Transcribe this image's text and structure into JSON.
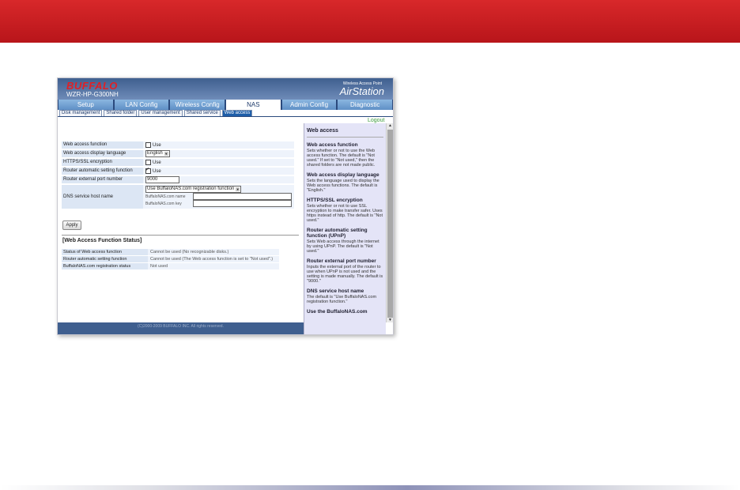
{
  "header": {
    "brand": "BUFFALO",
    "model": "WZR-HP-G300NH",
    "wap_label": "Wireless Access Point",
    "product": "AirStation"
  },
  "tabs": [
    {
      "label": "Setup",
      "active": false
    },
    {
      "label": "LAN Config",
      "active": false
    },
    {
      "label": "Wireless Config",
      "active": false
    },
    {
      "label": "NAS",
      "active": true
    },
    {
      "label": "Admin Config",
      "active": false
    },
    {
      "label": "Diagnostic",
      "active": false
    }
  ],
  "subtabs": [
    {
      "label": "Disk management",
      "active": false
    },
    {
      "label": "Shared folder",
      "active": false
    },
    {
      "label": "User management",
      "active": false
    },
    {
      "label": "Shared service",
      "active": false
    },
    {
      "label": "Web access",
      "active": true
    }
  ],
  "logout": "Logout",
  "form": {
    "web_access_function": {
      "label": "Web access function",
      "option": "Use",
      "checked": false
    },
    "display_language": {
      "label": "Web access display language",
      "value": "English"
    },
    "https": {
      "label": "HTTPS/SSL encryption",
      "option": "Use",
      "checked": false
    },
    "router_auto": {
      "label": "Router automatic setting function",
      "option": "Use",
      "checked": true
    },
    "external_port": {
      "label": "Router external port number",
      "value": "9000"
    },
    "dns": {
      "label": "DNS service host name",
      "select_value": "Use BuffaloNAS.com registration function",
      "name_label": "BuffaloNAS.com name",
      "key_label": "BuffaloNAS.com key"
    },
    "apply_label": "Apply"
  },
  "status": {
    "title": "[Web Access Function Status]",
    "rows": [
      {
        "label": "Status of Web access function",
        "value": "Cannot be used (No recognizable disks.)"
      },
      {
        "label": "Router automatic setting function",
        "value": "Cannot be used (The Web access function is set to \"Not used\".)"
      },
      {
        "label": "BuffaloNAS.com registration status",
        "value": "Not used"
      }
    ]
  },
  "footer": "(C)2000-2009 BUFFALO INC. All rights reserved.",
  "help": {
    "title": "Web access",
    "sections": [
      {
        "title": "Web access function",
        "text": "Sets whether or not to use the Web access function. The default is \"Not used.\" If set to \"Not used,\" then the shared folders are not made public."
      },
      {
        "title": "Web access display language",
        "text": "Sets the language used to display the Web access functions. The default is \"English.\""
      },
      {
        "title": "HTTPS/SSL encryption",
        "text": "Sets whether or not to use SSL encryption to make transfer safer. Uses https instead of http. The default is \"Not used.\""
      },
      {
        "title": "Router automatic setting function (UPnP)",
        "text": "Sets Web access through the internet by using UPnP. The default is \"Not used.\""
      },
      {
        "title": "Router external port number",
        "text": "Inputs the external port of the router to use when UPnP is not used and the setting is made manually. The default is \"9000.\""
      },
      {
        "title": "DNS service host name",
        "text": "The default is \"Use BuffaloNAS.com registration function.\""
      },
      {
        "title": "Use the BuffaloNAS.com",
        "text": ""
      }
    ]
  }
}
